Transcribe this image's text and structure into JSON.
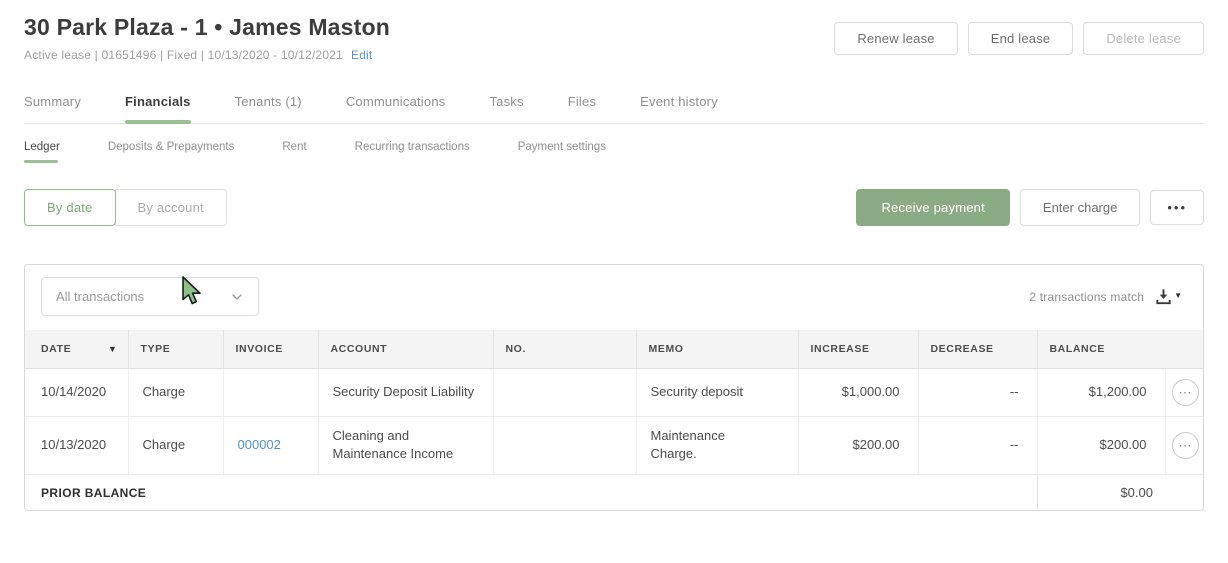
{
  "header": {
    "title": "30 Park Plaza - 1 • James Maston",
    "lease_meta": "Active lease | 01651496 | Fixed | 10/13/2020 - 10/12/2021",
    "edit_label": "Edit",
    "actions": {
      "renew": "Renew lease",
      "end": "End lease",
      "delete": "Delete lease"
    }
  },
  "tabs": [
    {
      "label": "Summary"
    },
    {
      "label": "Financials"
    },
    {
      "label": "Tenants (1)"
    },
    {
      "label": "Communications"
    },
    {
      "label": "Tasks"
    },
    {
      "label": "Files"
    },
    {
      "label": "Event history"
    }
  ],
  "subtabs": [
    {
      "label": "Ledger"
    },
    {
      "label": "Deposits & Prepayments"
    },
    {
      "label": "Rent"
    },
    {
      "label": "Recurring transactions"
    },
    {
      "label": "Payment settings"
    }
  ],
  "view_toggle": {
    "by_date": "By date",
    "by_account": "By account"
  },
  "toolbar": {
    "receive_payment": "Receive payment",
    "enter_charge": "Enter charge",
    "more": "•••"
  },
  "filter": {
    "selected": "All transactions"
  },
  "match_text": "2 transactions match",
  "table": {
    "columns": {
      "date": "DATE",
      "type": "TYPE",
      "invoice": "INVOICE",
      "account": "ACCOUNT",
      "no": "NO.",
      "memo": "MEMO",
      "increase": "INCREASE",
      "decrease": "DECREASE",
      "balance": "BALANCE"
    },
    "rows": [
      {
        "date": "10/14/2020",
        "type": "Charge",
        "invoice": "",
        "account": "Security Deposit Liability",
        "no": "",
        "memo": "Security deposit",
        "increase": "$1,000.00",
        "decrease": "--",
        "balance": "$1,200.00"
      },
      {
        "date": "10/13/2020",
        "type": "Charge",
        "invoice": "000002",
        "account": "Cleaning and Maintenance Income",
        "no": "",
        "memo": "Maintenance Charge.",
        "increase": "$200.00",
        "decrease": "--",
        "balance": "$200.00"
      }
    ],
    "footer": {
      "label": "PRIOR BALANCE",
      "balance": "$0.00"
    }
  },
  "colors": {
    "accent_green": "#8aab84",
    "underline_green": "#9abf93",
    "link_blue": "#4e94cb"
  }
}
